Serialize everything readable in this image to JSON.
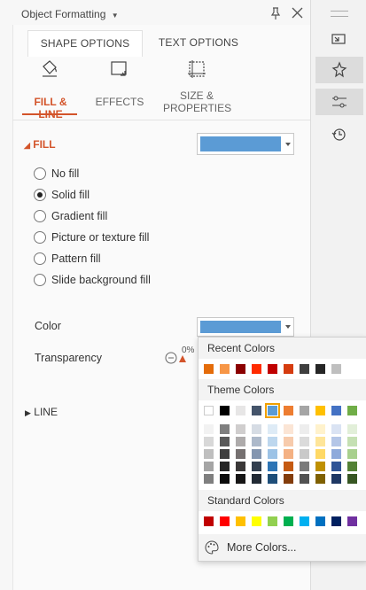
{
  "panel": {
    "title": "Object Formatting",
    "tabs": [
      {
        "label": "SHAPE OPTIONS",
        "active": true
      },
      {
        "label": "TEXT OPTIONS",
        "active": false
      }
    ],
    "subtabs": [
      {
        "label": "FILL & LINE",
        "active": true,
        "icon": "paint-bucket-icon"
      },
      {
        "label": "EFFECTS",
        "active": false,
        "icon": "effects-icon"
      },
      {
        "label": "SIZE & PROPERTIES",
        "active": false,
        "icon": "size-properties-icon"
      }
    ],
    "fill_section": {
      "label": "FILL",
      "swatch_color": "#5b9bd5",
      "options": [
        {
          "label": "No fill",
          "selected": false
        },
        {
          "label": "Solid fill",
          "selected": true
        },
        {
          "label": "Gradient fill",
          "selected": false
        },
        {
          "label": "Picture or texture fill",
          "selected": false
        },
        {
          "label": "Pattern fill",
          "selected": false
        },
        {
          "label": "Slide background fill",
          "selected": false
        }
      ],
      "color_label": "Color",
      "transparency_label": "Transparency",
      "transparency_value": "0%"
    },
    "line_section": {
      "label": "LINE"
    }
  },
  "right_bar": {
    "icons": [
      "handle-icon",
      "present-icon",
      "pin-animation-icon",
      "settings-sliders-icon",
      "history-icon"
    ]
  },
  "color_popup": {
    "recent_label": "Recent Colors",
    "recent_colors": [
      "#e46c0a",
      "#f79646",
      "#8b0000",
      "#ff2b00",
      "#c00000",
      "#d53c0f",
      "#3f3f3f",
      "#262626",
      "#bfbfbf"
    ],
    "theme_label": "Theme Colors",
    "theme_top": [
      "#ffffff",
      "#000000",
      "#e7e6e6",
      "#44546a",
      "#5b9bd5",
      "#ed7d31",
      "#a5a5a5",
      "#ffc000",
      "#4472c4",
      "#70ad47"
    ],
    "theme_shades": [
      [
        "#f2f2f2",
        "#7f7f7f",
        "#d0cece",
        "#d6dce4",
        "#deebf6",
        "#fbe5d5",
        "#ededed",
        "#fff2cc",
        "#dae3f3",
        "#e2efd9"
      ],
      [
        "#d8d8d8",
        "#595959",
        "#aeabab",
        "#adb9ca",
        "#bdd7ee",
        "#f7cbac",
        "#dbdbdb",
        "#fee599",
        "#b4c6e7",
        "#c5e0b3"
      ],
      [
        "#bfbfbf",
        "#3f3f3f",
        "#757070",
        "#8496b0",
        "#9dc3e6",
        "#f4b183",
        "#c9c9c9",
        "#ffd965",
        "#8eaadb",
        "#a8d08d"
      ],
      [
        "#a5a5a5",
        "#262626",
        "#3a3838",
        "#323f4f",
        "#2e75b5",
        "#c55a11",
        "#7b7b7b",
        "#bf9000",
        "#2f5496",
        "#538135"
      ],
      [
        "#7f7f7f",
        "#0c0c0c",
        "#171616",
        "#222a35",
        "#1e4e79",
        "#833c0b",
        "#525252",
        "#7f6000",
        "#1f3864",
        "#375623"
      ]
    ],
    "selected_theme_color": "#5b9bd5",
    "standard_label": "Standard Colors",
    "standard_colors": [
      "#c00000",
      "#ff0000",
      "#ffc000",
      "#ffff00",
      "#92d050",
      "#00b050",
      "#00b0f0",
      "#0070c0",
      "#002060",
      "#7030a0"
    ],
    "more_label": "More Colors..."
  }
}
